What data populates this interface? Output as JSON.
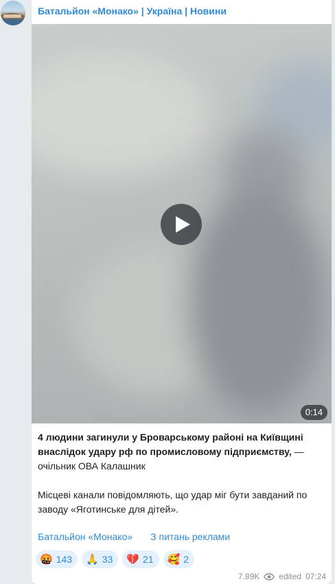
{
  "channel": {
    "title": "Батальйон «Монако» | Україна | Новини"
  },
  "video": {
    "duration": "0:14",
    "play_icon": "play-icon"
  },
  "message": {
    "bold_text": "4 людини загинули у Броварському районі на Київщині внаслідок удару рф по промисловому підприємству,",
    "bold_suffix": " — очільник ОВА Калашник",
    "paragraph2": "Місцеві канали повідомляють, що удар міг бути завданий по заводу «Яготинське для дітей»."
  },
  "links": {
    "channel_link": "Батальйон «Монако»",
    "ads_link": "З питань реклами"
  },
  "reactions": [
    {
      "emoji": "🤬",
      "count": "143"
    },
    {
      "emoji": "🙏",
      "count": "33"
    },
    {
      "emoji": "💔",
      "count": "21"
    },
    {
      "emoji": "🥰",
      "count": "2"
    }
  ],
  "meta": {
    "views": "7.89K",
    "views_icon": "eye-icon",
    "edited": "edited",
    "time": "07:24"
  },
  "colors": {
    "accent": "#2f8bd4",
    "background": "#e6ebee",
    "reaction_bg": "#e4f0fb"
  }
}
